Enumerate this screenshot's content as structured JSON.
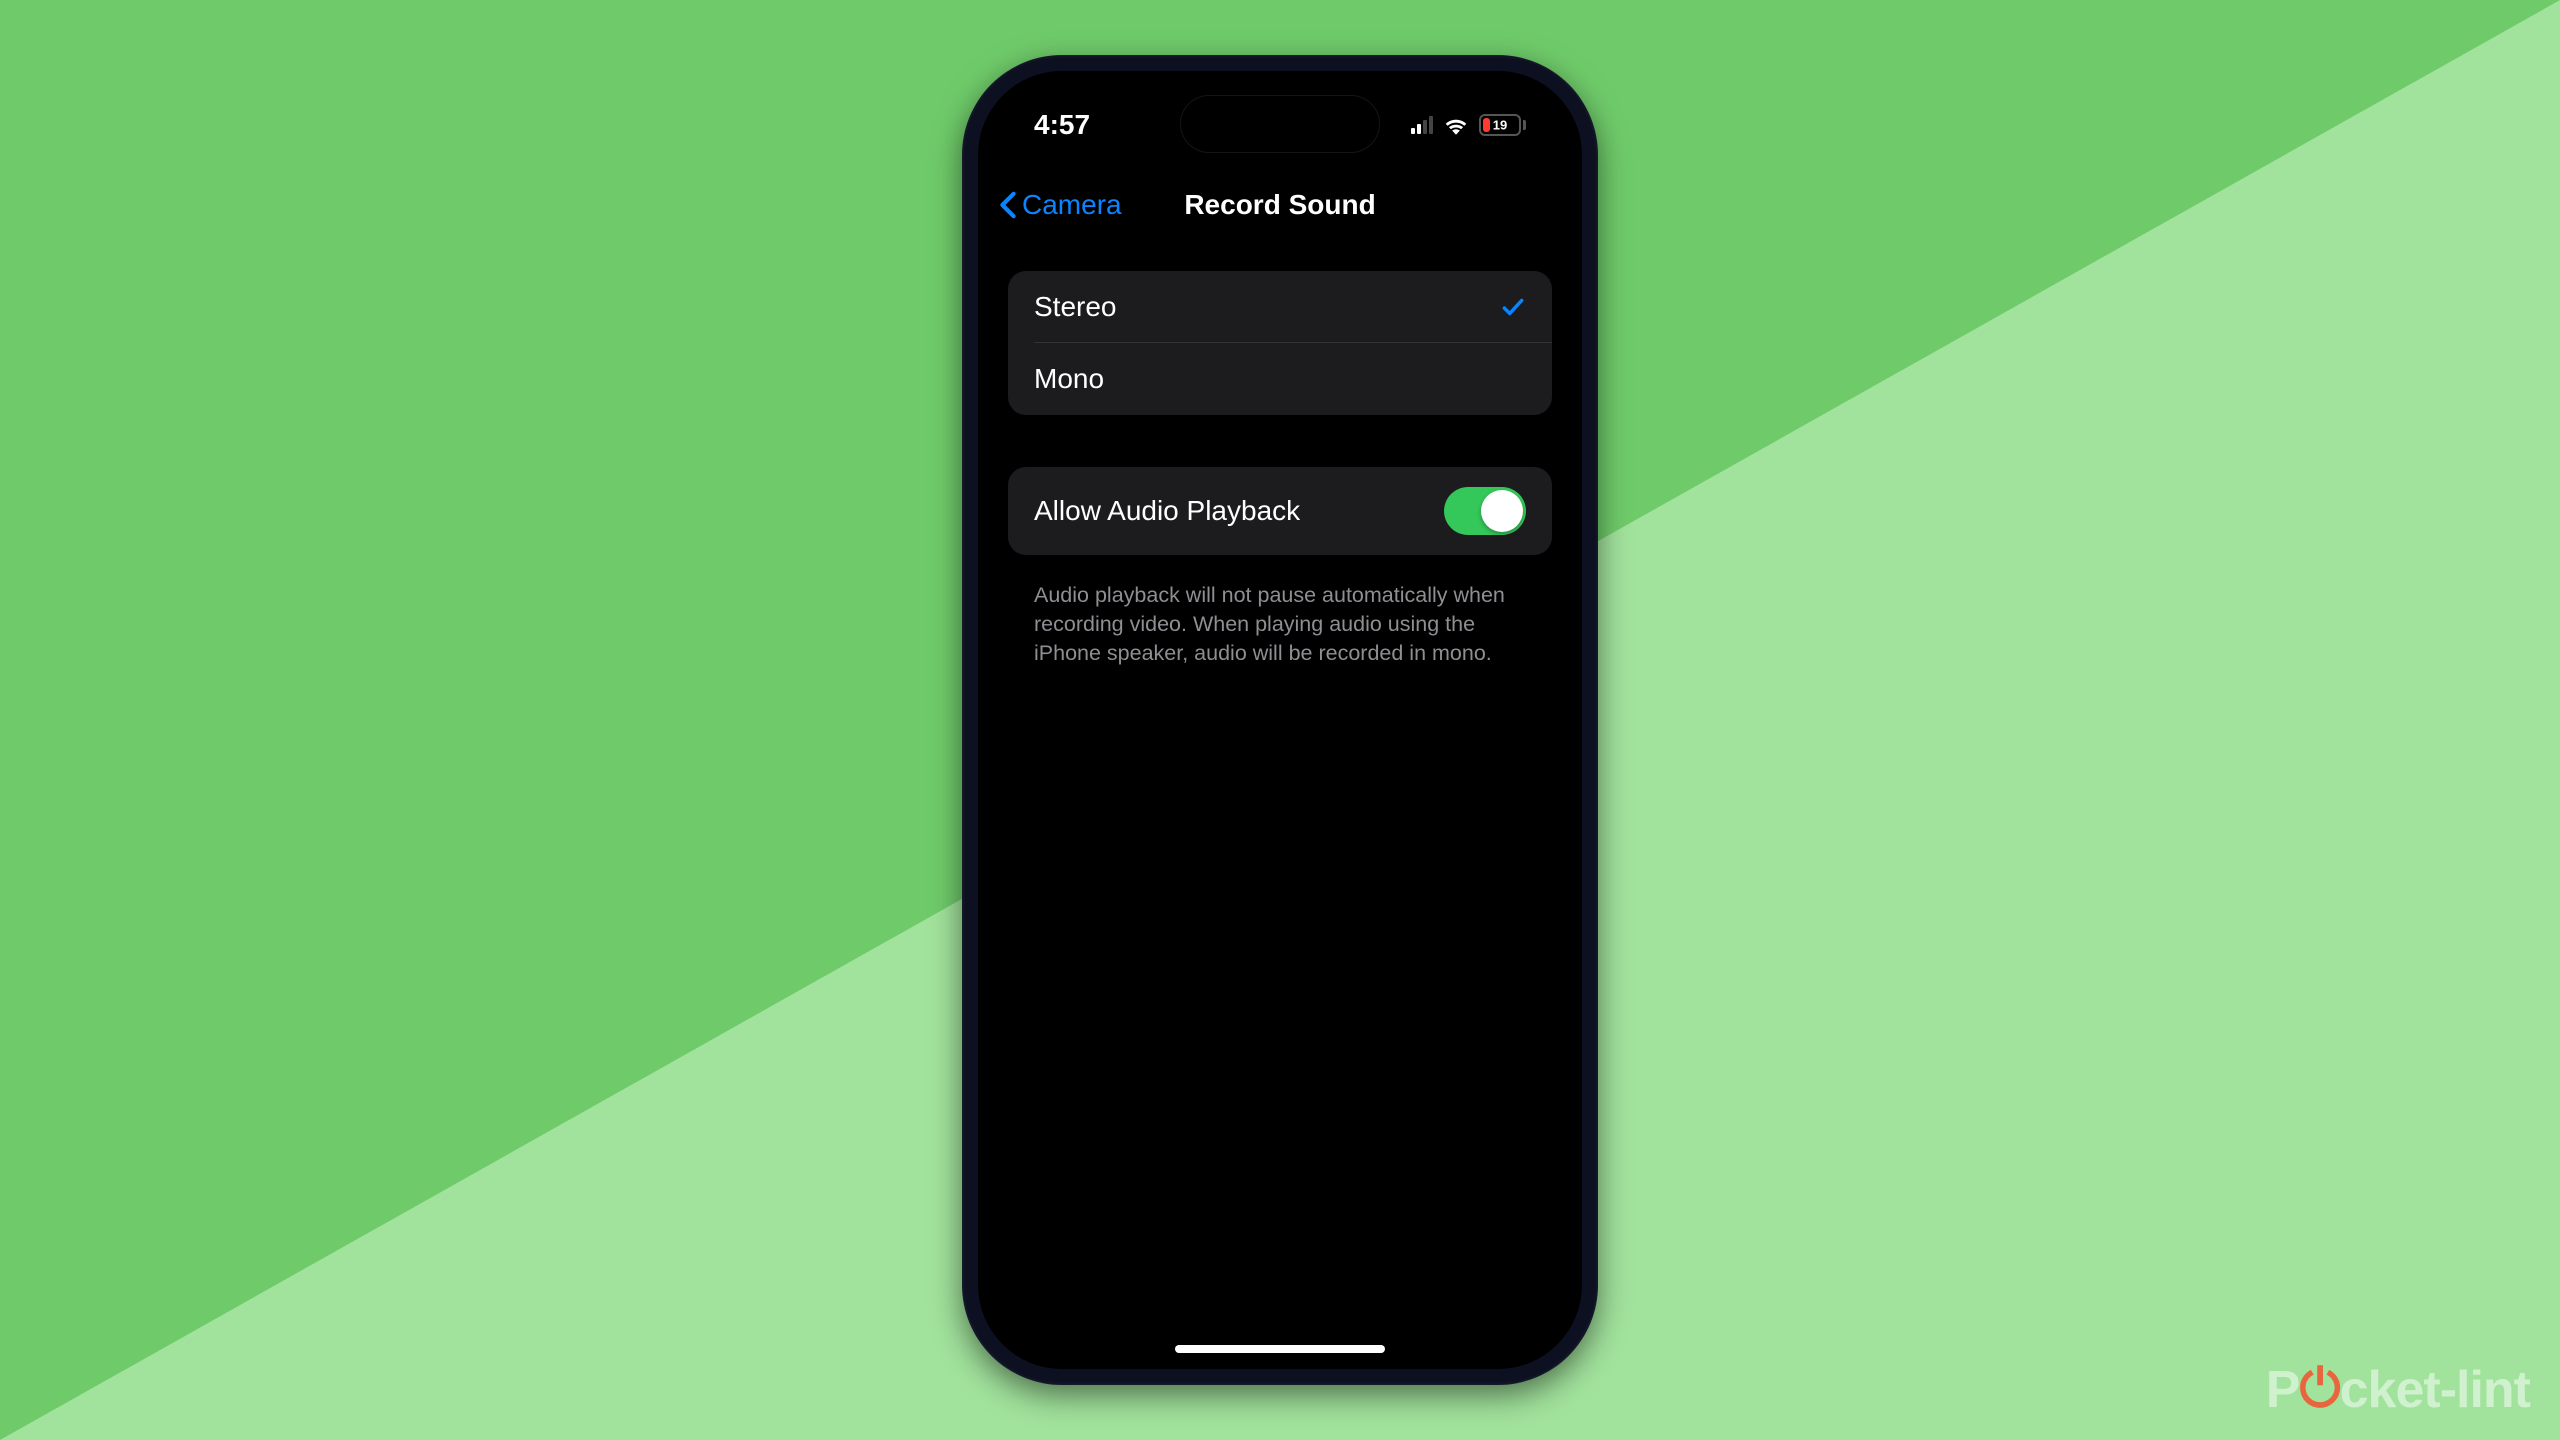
{
  "status": {
    "time": "4:57",
    "battery_pct": "19"
  },
  "nav": {
    "back_label": "Camera",
    "title": "Record Sound"
  },
  "sound_options": {
    "stereo": "Stereo",
    "mono": "Mono"
  },
  "playback": {
    "label": "Allow Audio Playback",
    "footer": "Audio playback will not pause automatically when recording video. When playing audio using the iPhone speaker, audio will be recorded in mono."
  },
  "watermark": {
    "part1": "P",
    "part2": "cket-lint"
  }
}
